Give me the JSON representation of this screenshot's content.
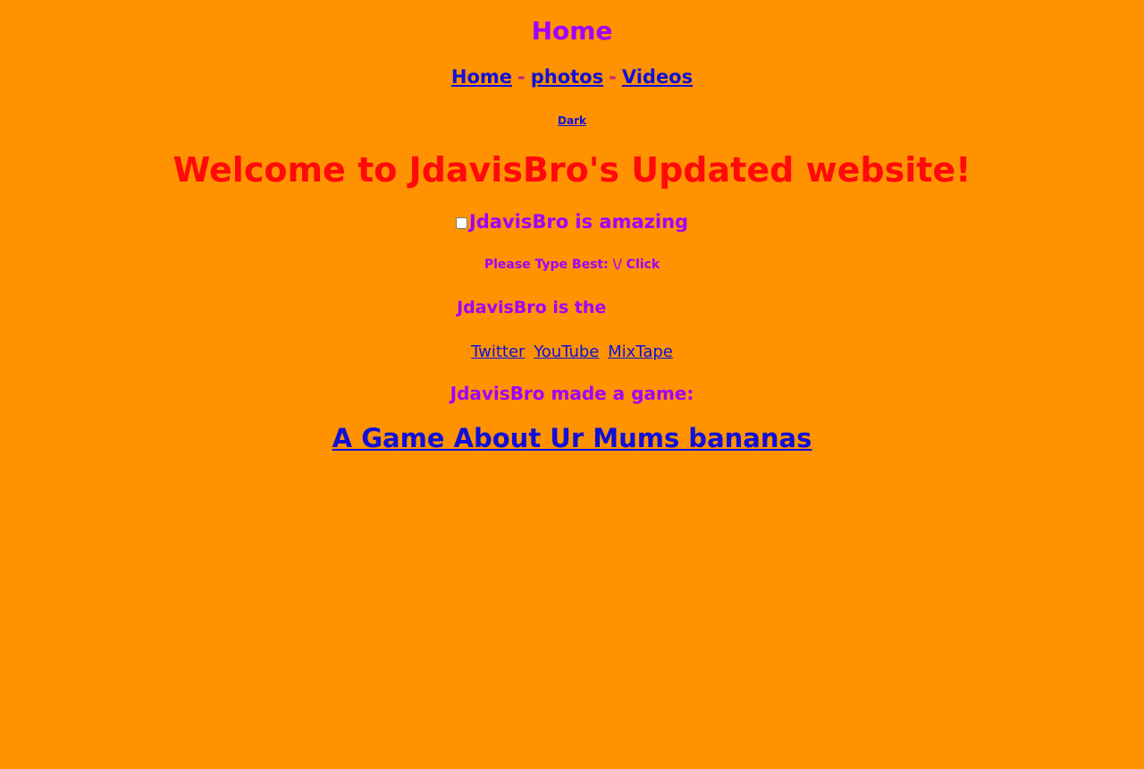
{
  "header": {
    "title": "Home"
  },
  "nav": {
    "items": [
      {
        "label": "Home"
      },
      {
        "label": "photos"
      },
      {
        "label": "Videos"
      }
    ],
    "separator": "-"
  },
  "theme_toggle": {
    "label": "Dark"
  },
  "welcome": {
    "text": "Welcome to JdavisBro's Updated website!"
  },
  "checkbox": {
    "label": "JdavisBro is amazing",
    "checked": false
  },
  "prompt": {
    "text": "Please Type Best: \\/ Click"
  },
  "best_field": {
    "label": "JdavisBro is the",
    "value": "",
    "placeholder": ""
  },
  "social_links": [
    {
      "label": "Twitter"
    },
    {
      "label": "YouTube"
    },
    {
      "label": "MixTape"
    }
  ],
  "game": {
    "label": "JdavisBro made a game:",
    "link_text": "A Game About Ur Mums bananas"
  },
  "colors": {
    "background": "#ff9200",
    "heading_purple": "#a000ff",
    "welcome_red": "#ff0a0a",
    "link_blue": "#1010d8",
    "separator": "#c02080"
  }
}
